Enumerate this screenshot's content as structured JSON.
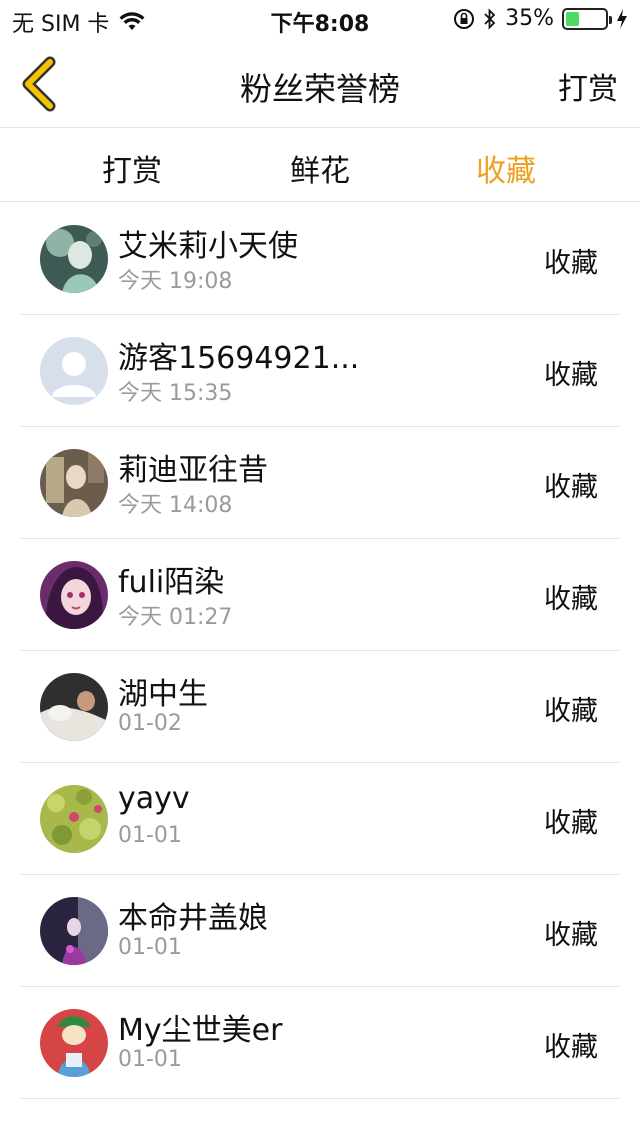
{
  "status_bar": {
    "carrier": "无 SIM 卡",
    "time": "下午8:08",
    "battery_percent": "35%",
    "battery_level": 0.35,
    "wifi_icon": "wifi-icon",
    "bluetooth_icon": "bluetooth-icon",
    "lock_icon": "rotation-lock-icon",
    "charging_icon": "charging-icon"
  },
  "nav": {
    "title": "粉丝荣誉榜",
    "right_label": "打赏",
    "back_icon": "chevron-left-icon",
    "back_color": "#f5c400"
  },
  "tabs": [
    {
      "label": "打赏",
      "active": false
    },
    {
      "label": "鲜花",
      "active": false
    },
    {
      "label": "收藏",
      "active": true
    }
  ],
  "accent_color": "#f0a020",
  "fans": [
    {
      "name": "艾米莉小天使",
      "time": "今天 19:08",
      "action": "收藏",
      "avatar": "avatar-green"
    },
    {
      "name": "游客15694921...",
      "time": "今天 15:35",
      "action": "收藏",
      "avatar": "avatar-default"
    },
    {
      "name": "莉迪亚往昔",
      "time": "今天 14:08",
      "action": "收藏",
      "avatar": "avatar-vintage"
    },
    {
      "name": "fuli陌染",
      "time": "今天 01:27",
      "action": "收藏",
      "avatar": "avatar-anime"
    },
    {
      "name": "湖中生",
      "time": "01-02",
      "action": "收藏",
      "avatar": "avatar-photo"
    },
    {
      "name": "yayv",
      "time": "01-01",
      "action": "收藏",
      "avatar": "avatar-knit"
    },
    {
      "name": "本命井盖娘",
      "time": "01-01",
      "action": "收藏",
      "avatar": "avatar-dark"
    },
    {
      "name": "My尘世美er",
      "time": "01-01",
      "action": "收藏",
      "avatar": "avatar-red"
    }
  ]
}
